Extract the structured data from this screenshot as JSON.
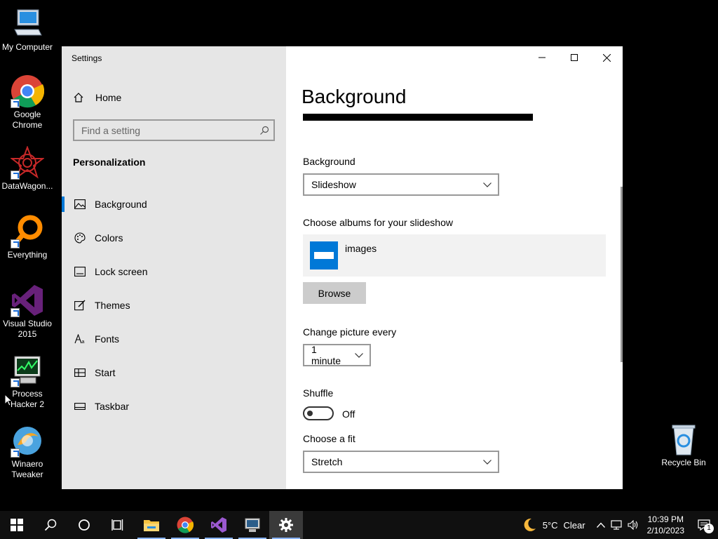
{
  "desktop": {
    "icons": [
      {
        "label": "My Computer",
        "icon": "monitor-icon"
      },
      {
        "label": "Google Chrome",
        "icon": "chrome-icon"
      },
      {
        "label": "DataWagon...",
        "icon": "datawagon-icon"
      },
      {
        "label": "Everything",
        "icon": "everything-search-icon"
      },
      {
        "label": "Visual Studio 2015",
        "icon": "visual-studio-icon"
      },
      {
        "label": "Process Hacker 2",
        "icon": "process-hacker-icon"
      },
      {
        "label": "Winaero Tweaker",
        "icon": "winaero-icon"
      },
      {
        "label": "Recycle Bin",
        "icon": "recycle-bin-icon"
      }
    ]
  },
  "window": {
    "title": "Settings",
    "controls": {
      "minimize": "minimize-icon",
      "maximize": "maximize-icon",
      "close": "close-icon"
    }
  },
  "sidebar": {
    "home_label": "Home",
    "search": {
      "placeholder": "Find a setting"
    },
    "section_title": "Personalization",
    "items": [
      {
        "label": "Background",
        "icon": "image-icon",
        "active": true
      },
      {
        "label": "Colors",
        "icon": "palette-icon",
        "active": false
      },
      {
        "label": "Lock screen",
        "icon": "lock-screen-icon",
        "active": false
      },
      {
        "label": "Themes",
        "icon": "brush-icon",
        "active": false
      },
      {
        "label": "Fonts",
        "icon": "font-icon",
        "active": false
      },
      {
        "label": "Start",
        "icon": "start-menu-icon",
        "active": false
      },
      {
        "label": "Taskbar",
        "icon": "taskbar-icon",
        "active": false
      }
    ]
  },
  "main": {
    "title": "Background",
    "background": {
      "label": "Background",
      "value": "Slideshow"
    },
    "albums": {
      "label": "Choose albums for your slideshow",
      "album_name": "images",
      "browse_label": "Browse"
    },
    "change_picture": {
      "label": "Change picture every",
      "value": "1 minute"
    },
    "shuffle": {
      "label": "Shuffle",
      "state": "Off"
    },
    "fit": {
      "label": "Choose a fit",
      "value": "Stretch"
    }
  },
  "taskbar": {
    "weather": {
      "temperature": "5°C",
      "condition": "Clear"
    },
    "clock": {
      "time": "10:39 PM",
      "date": "2/10/2023"
    },
    "notification_count": "1"
  },
  "colors": {
    "accent": "#0078d7",
    "sidebar_bg": "#e6e6e6",
    "taskbar_bg": "#101010"
  }
}
